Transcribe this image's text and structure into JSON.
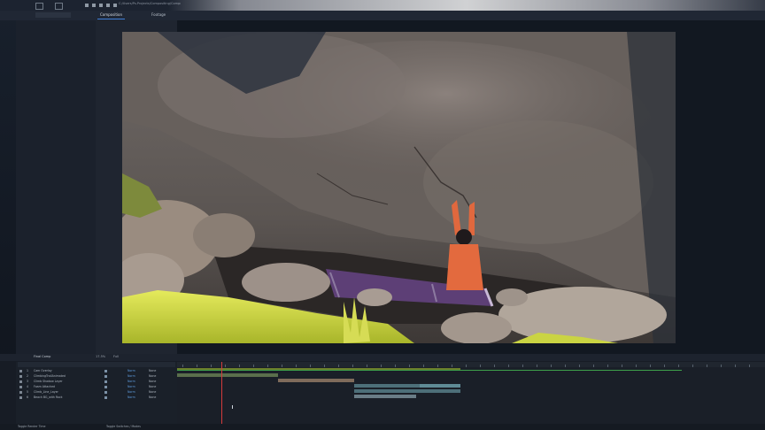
{
  "app": {
    "file_path": "C:/Users/Ps-Projects/Compositing/Composition"
  },
  "panels": {
    "composition_tab": "Composition",
    "footage_tab": "Footage",
    "viewer_zoom": "17.5%",
    "viewer_res": "Full"
  },
  "timeline": {
    "comp_name": "Final Comp",
    "layers": [
      {
        "num": "1",
        "name": "Cam Overlay",
        "mode": "Norm",
        "parent": "None"
      },
      {
        "num": "2",
        "name": "ClimbingTrailAnimated",
        "mode": "Norm",
        "parent": "None"
      },
      {
        "num": "3",
        "name": "Climb Shadow Layer",
        "mode": "Norm",
        "parent": "None"
      },
      {
        "num": "4",
        "name": "Foam Attached",
        "mode": "Norm",
        "parent": "None"
      },
      {
        "num": "5",
        "name": "Climb_Line_Layer",
        "mode": "Norm",
        "parent": "None"
      },
      {
        "num": "6",
        "name": "Beach BG_with Rock",
        "mode": "Norm",
        "parent": "None"
      }
    ],
    "status_left": "Toggle Render Time",
    "status_mid": "Toggle Switches / Modes"
  },
  "colors": {
    "accent": "#3f7fd8",
    "playhead": "#d43b3b",
    "work_area": "#6b7d2b"
  }
}
